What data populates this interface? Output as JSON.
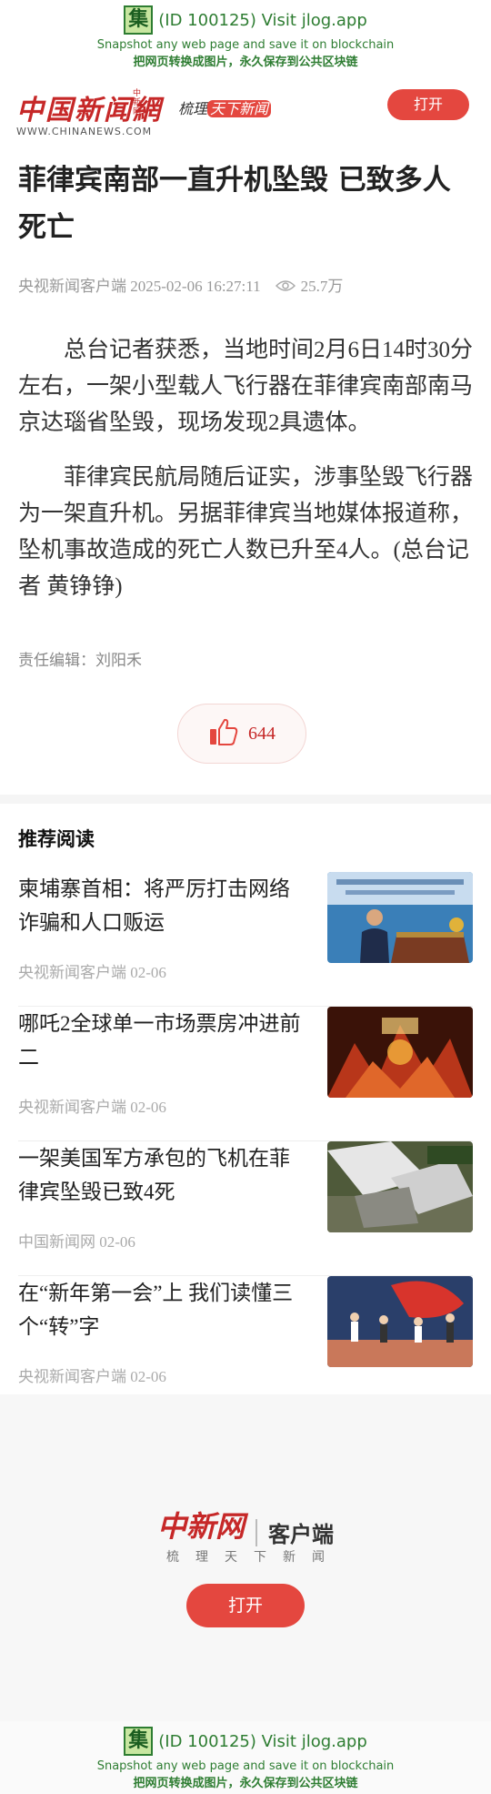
{
  "jlog": {
    "icon_char": "集",
    "link": "(ID 100125) Visit jlog.app",
    "line1": "Snapshot any web page and save it on blockchain",
    "line2": "把网页转换成图片，永久保存到公共区块链"
  },
  "header": {
    "logo_cn": "中国新闻網",
    "logo_small": "中新网",
    "logo_en": "WWW.CHINANEWS.COM",
    "slogan_pre": "梳理",
    "slogan_hl": "天下新闻",
    "open_label": "打开"
  },
  "article": {
    "title": "菲律宾南部一直升机坠毁 已致多人死亡",
    "source_time": "央视新闻客户端 2025-02-06 16:27:11",
    "views": "25.7万",
    "paragraphs": [
      "总台记者获悉，当地时间2月6日14时30分左右，一架小型载人飞行器在菲律宾南部南马京达瑙省坠毁，现场发现2具遗体。",
      "菲律宾民航局随后证实，涉事坠毁飞行器为一架直升机。另据菲律宾当地媒体报道称，坠机事故造成的死亡人数已升至4人。(总台记者 黄铮铮)"
    ],
    "editor": "责任编辑：刘阳禾",
    "likes": "644"
  },
  "recommend": {
    "heading": "推荐阅读",
    "items": [
      {
        "title": "柬埔寨首相：将严厉打击网络诈骗和人口贩运",
        "source": "央视新闻客户端 02-06"
      },
      {
        "title": "哪吒2全球单一市场票房冲进前二",
        "source": "央视新闻客户端 02-06"
      },
      {
        "title": "一架美国军方承包的飞机在菲律宾坠毁已致4死",
        "source": "中国新闻网 02-06"
      },
      {
        "title": "在“新年第一会”上 我们读懂三个“转”字",
        "source": "央视新闻客户端 02-06"
      }
    ]
  },
  "footer": {
    "logo_cn": "中新网",
    "app_label": "客户端",
    "slogan": "梳理天下新闻",
    "open_label": "打开"
  },
  "colors": {
    "accent": "#e4473f",
    "brand_red": "#c62828",
    "jlog_green": "#2e7d32"
  }
}
